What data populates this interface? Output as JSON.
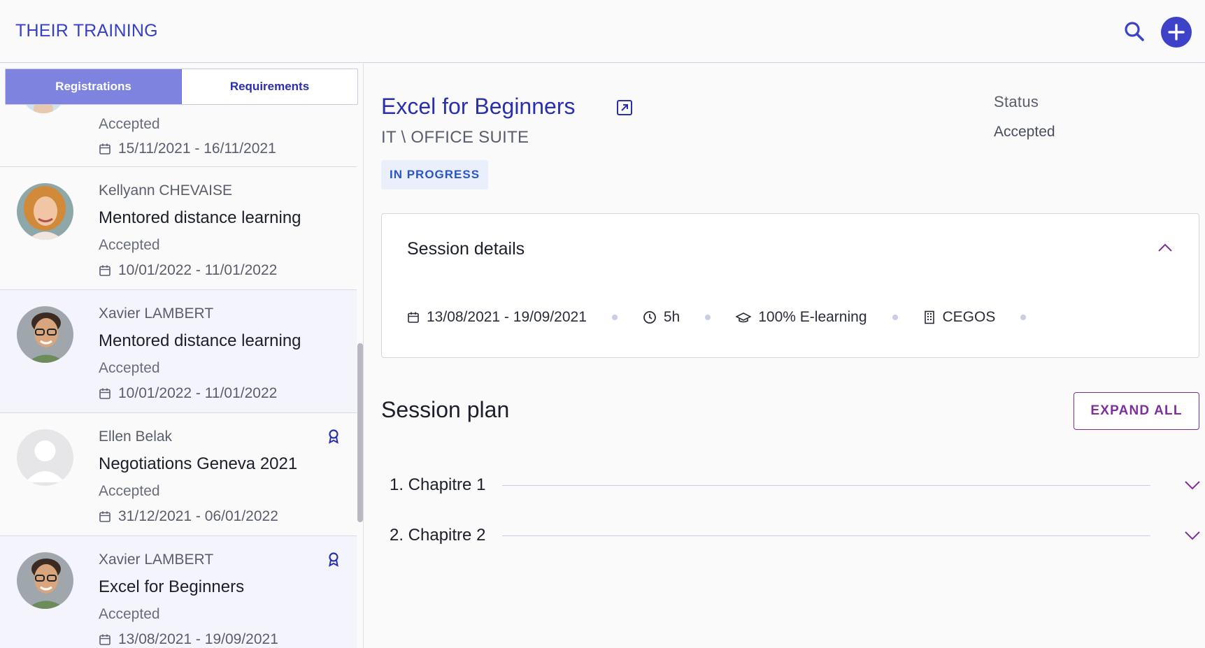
{
  "header": {
    "title": "THEIR TRAINING",
    "search_icon": "search-icon",
    "add_icon": "plus-icon",
    "accent": "#3e42c8"
  },
  "tabs": [
    {
      "label": "Registrations",
      "active": true
    },
    {
      "label": "Requirements",
      "active": false
    }
  ],
  "registrations": [
    {
      "name": "",
      "course": "",
      "status": "Accepted",
      "dates": "15/11/2021 - 16/11/2021",
      "certificate": false,
      "partial": true
    },
    {
      "name": "Kellyann CHEVAISE",
      "course": "Mentored distance learning",
      "status": "Accepted",
      "dates": "10/01/2022 - 11/01/2022",
      "certificate": false
    },
    {
      "name": "Xavier LAMBERT",
      "course": "Mentored distance learning",
      "status": "Accepted",
      "dates": "10/01/2022 - 11/01/2022",
      "certificate": false
    },
    {
      "name": "Ellen Belak",
      "course": "Negotiations Geneva 2021",
      "status": "Accepted",
      "dates": "31/12/2021 - 06/01/2022",
      "certificate": true
    },
    {
      "name": "Xavier LAMBERT",
      "course": "Excel for Beginners",
      "status": "Accepted",
      "dates": "13/08/2021 - 19/09/2021",
      "certificate": true
    }
  ],
  "course": {
    "title": "Excel for Beginners",
    "breadcrumb": "IT \\ OFFICE SUITE",
    "badge": "IN PROGRESS",
    "status_label": "Status",
    "status_value": "Accepted"
  },
  "session_details": {
    "title": "Session details",
    "dates": "13/08/2021 - 19/09/2021",
    "duration": "5h",
    "modality": "100% E-learning",
    "provider": "CEGOS"
  },
  "session_plan": {
    "title": "Session plan",
    "expand_label": "EXPAND ALL",
    "chapters": [
      {
        "label": "1. Chapitre 1"
      },
      {
        "label": "2. Chapitre 2"
      }
    ]
  }
}
